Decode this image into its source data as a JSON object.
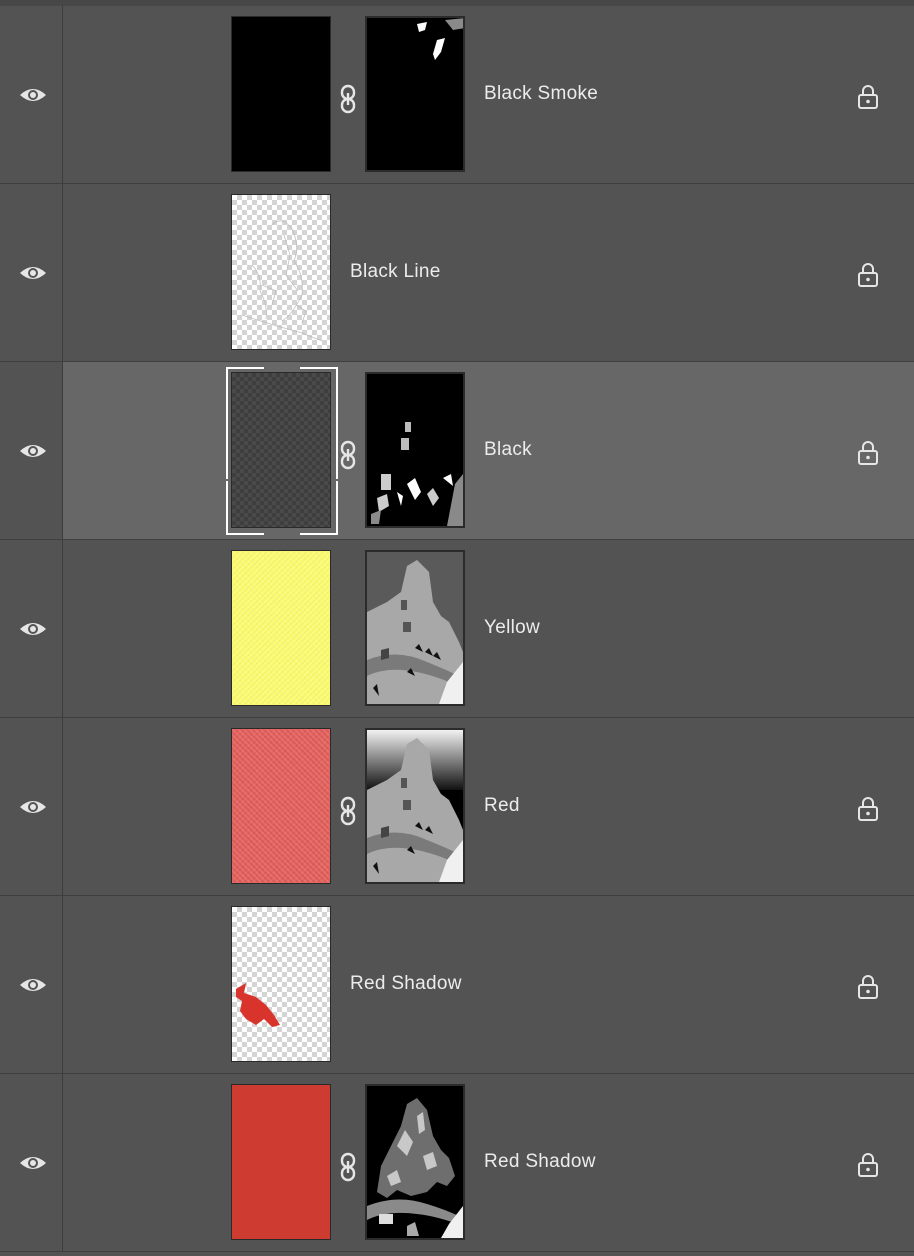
{
  "panel": "Layers",
  "selected_layer_index": 2,
  "layers": [
    {
      "name": "Black Smoke",
      "visible": true,
      "locked": true,
      "linked_mask": true,
      "fill": "black",
      "mask": "smoke"
    },
    {
      "name": "Black Line",
      "visible": true,
      "locked": true,
      "linked_mask": false,
      "fill": "lineart"
    },
    {
      "name": "Black",
      "visible": true,
      "locked": true,
      "linked_mask": true,
      "fill": "transparent-dark",
      "mask": "black-details"
    },
    {
      "name": "Yellow",
      "visible": true,
      "locked": false,
      "linked_mask": false,
      "fill": "yellow",
      "mask": "mountain-gray"
    },
    {
      "name": "Red",
      "visible": true,
      "locked": true,
      "linked_mask": true,
      "fill": "red-light",
      "mask": "mountain-gradient"
    },
    {
      "name": "Red Shadow",
      "visible": true,
      "locked": true,
      "linked_mask": false,
      "fill": "red-shadow-shape"
    },
    {
      "name": "Red Shadow",
      "visible": true,
      "locked": true,
      "linked_mask": true,
      "fill": "red",
      "mask": "mountain-detailed"
    }
  ],
  "colors": {
    "panel_bg": "#535353",
    "selected_bg": "#676767",
    "text": "#ececec",
    "icon": "#e6e6e6",
    "yellow_fill": "#fbfb6e",
    "red_light_fill": "#e35f5b",
    "red_fill": "#cd3b31"
  },
  "icons": {
    "visibility": "eye-icon",
    "link": "chain-link-icon",
    "lock": "padlock-icon"
  }
}
